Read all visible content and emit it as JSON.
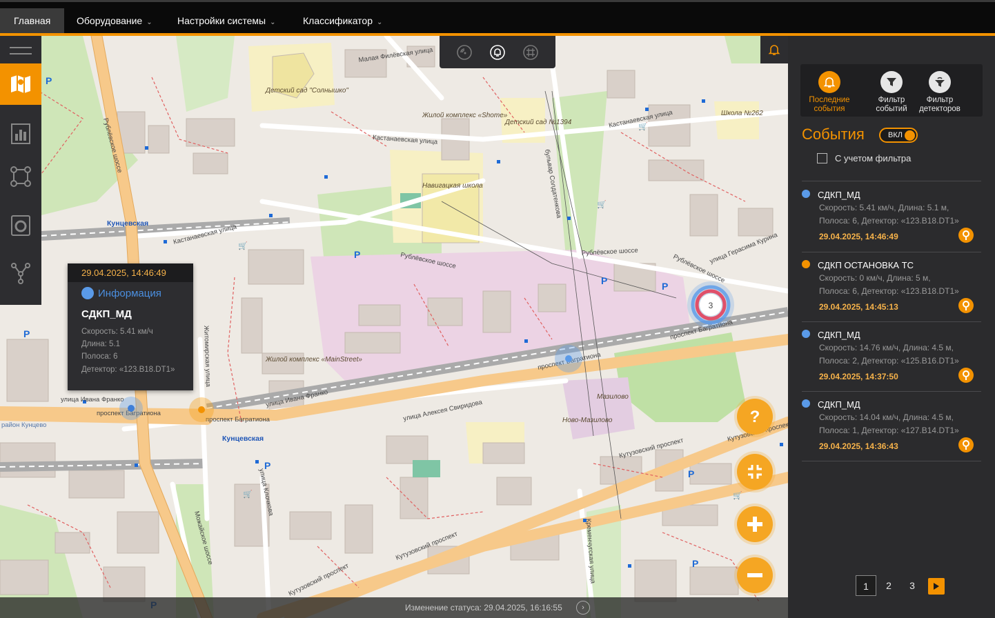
{
  "nav": {
    "items": [
      {
        "label": "Главная",
        "has_menu": false,
        "active": true
      },
      {
        "label": "Оборудование",
        "has_menu": true,
        "active": false
      },
      {
        "label": "Настройки системы",
        "has_menu": true,
        "active": false
      },
      {
        "label": "Классификатор",
        "has_menu": true,
        "active": false
      }
    ]
  },
  "map": {
    "labels": {
      "kuntsevskaya": "Кунцевская",
      "kuntsevskaya2": "Кунцевская",
      "kastanaevskaya1": "Кастанаевская улица",
      "kastanaevskaya2": "Кастанаевская улица",
      "kastanaevskaya3": "Кастанаевская улица",
      "rublevskoe1": "Рублёвское шоссе",
      "rublevskoe2": "Рублёвское шоссе",
      "rublevskoe3": "Рублёвское шоссе",
      "rublevskoe4": "Рублёвское шоссе",
      "bagrationa1": "проспект Багратиона",
      "bagrationa2": "проспект Багратиона",
      "bagrationa3": "проспект Багратиона",
      "bagrationa4": "проспект Багратиона",
      "franko1": "улица Ивана Франко",
      "franko2": "улица Ивана Франко",
      "kutuzovsky1": "Кутузовский проспект",
      "kutuzovsky2": "Кутузовский проспект",
      "kutuzovsky3": "Кутузовский проспект",
      "kutuzovsky4": "Кутузовский проспект",
      "zhitomirskaya": "Житомирская улица",
      "sviridova": "улица Алексея Свиридова",
      "klochkova": "улица Клочкова",
      "mozhaiskoe": "Можайское шоссе",
      "soldatenkova": "бульвар Солдатенкова",
      "kremenchugskaya": "Кременчугская улица",
      "malaya_filevskaya": "Малая Филёвская улица",
      "gerasima_kurina": "улица Герасима Курина",
      "school_nav": "Навигацкая школа",
      "sad_solnyshko": "Детский сад \"Солнышко\"",
      "sad_1394": "Детский сад №1394",
      "school_262": "Школа №262",
      "zhk_shome": "Жилой комплекс «Shome»",
      "zhk_mainstreet": "Жилой комплекс «MainStreet»",
      "mazilovo": "Мазилово",
      "novo_mazilovo": "Ново-Мазилово",
      "raion_kuntsevo": "район Кунцево",
      "cluster_count": "3"
    }
  },
  "popup": {
    "time": "29.04.2025, 14:46:49",
    "info_label": "Информация",
    "title": "СДКП_МД",
    "speed": "Скорость: 5.41 км/ч",
    "length": "Длина: 5.1",
    "lane": "Полоса: 6",
    "detector": "Детектор: «123.B18.DT1»"
  },
  "status": {
    "text": "Изменение статуса: 29.04.2025, 16:16:55"
  },
  "panel": {
    "tabs": [
      {
        "label": "Последние события",
        "active": true
      },
      {
        "label": "Фильтр событий",
        "active": false
      },
      {
        "label": "Фильтр детекторов",
        "active": false
      }
    ],
    "title": "События",
    "toggle_label": "ВКЛ",
    "toggle_on": true,
    "filter_check_label": "С учетом фильтра",
    "filter_checked": false,
    "events": [
      {
        "name": "СДКП_МД",
        "color": "#5a9ae8",
        "line1": "Скорость: 5.41 км/ч, Длина: 5.1 м,",
        "line2": "Полоса: 6, Детектор: «123.B18.DT1»",
        "time": "29.04.2025, 14:46:49"
      },
      {
        "name": "СДКП ОСТАНОВКА ТС",
        "color": "#f39200",
        "line1": "Скорость: 0 км/ч, Длина: 5 м,",
        "line2": "Полоса: 6, Детектор: «123.B18.DT1»",
        "time": "29.04.2025, 14:45:13"
      },
      {
        "name": "СДКП_МД",
        "color": "#5a9ae8",
        "line1": "Скорость: 14.76 км/ч, Длина: 4.5 м,",
        "line2": "Полоса: 2, Детектор: «125.B16.DT1»",
        "time": "29.04.2025, 14:37:50"
      },
      {
        "name": "СДКП_МД",
        "color": "#5a9ae8",
        "line1": "Скорость: 14.04 км/ч, Длина: 4.5 м,",
        "line2": "Полоса: 1, Детектор: «127.B14.DT1»",
        "time": "29.04.2025, 14:36:43"
      }
    ],
    "pager": {
      "pages": [
        "1",
        "2",
        "3"
      ],
      "current": "1"
    }
  },
  "colors": {
    "accent": "#f39200",
    "map_bg": "#eeeae4",
    "road_major": "#f7c98a",
    "green": "#cfe6b8",
    "building": "#d9d0c9"
  },
  "icons": {
    "sidebar": [
      "map-icon",
      "chart-icon",
      "route-icon",
      "camera-icon",
      "network-icon"
    ],
    "tools": [
      "signal-icon",
      "bell-icon",
      "grid-icon"
    ],
    "fabs": [
      "help-icon",
      "fullscreen-icon",
      "zoom-in-icon",
      "zoom-out-icon"
    ]
  }
}
